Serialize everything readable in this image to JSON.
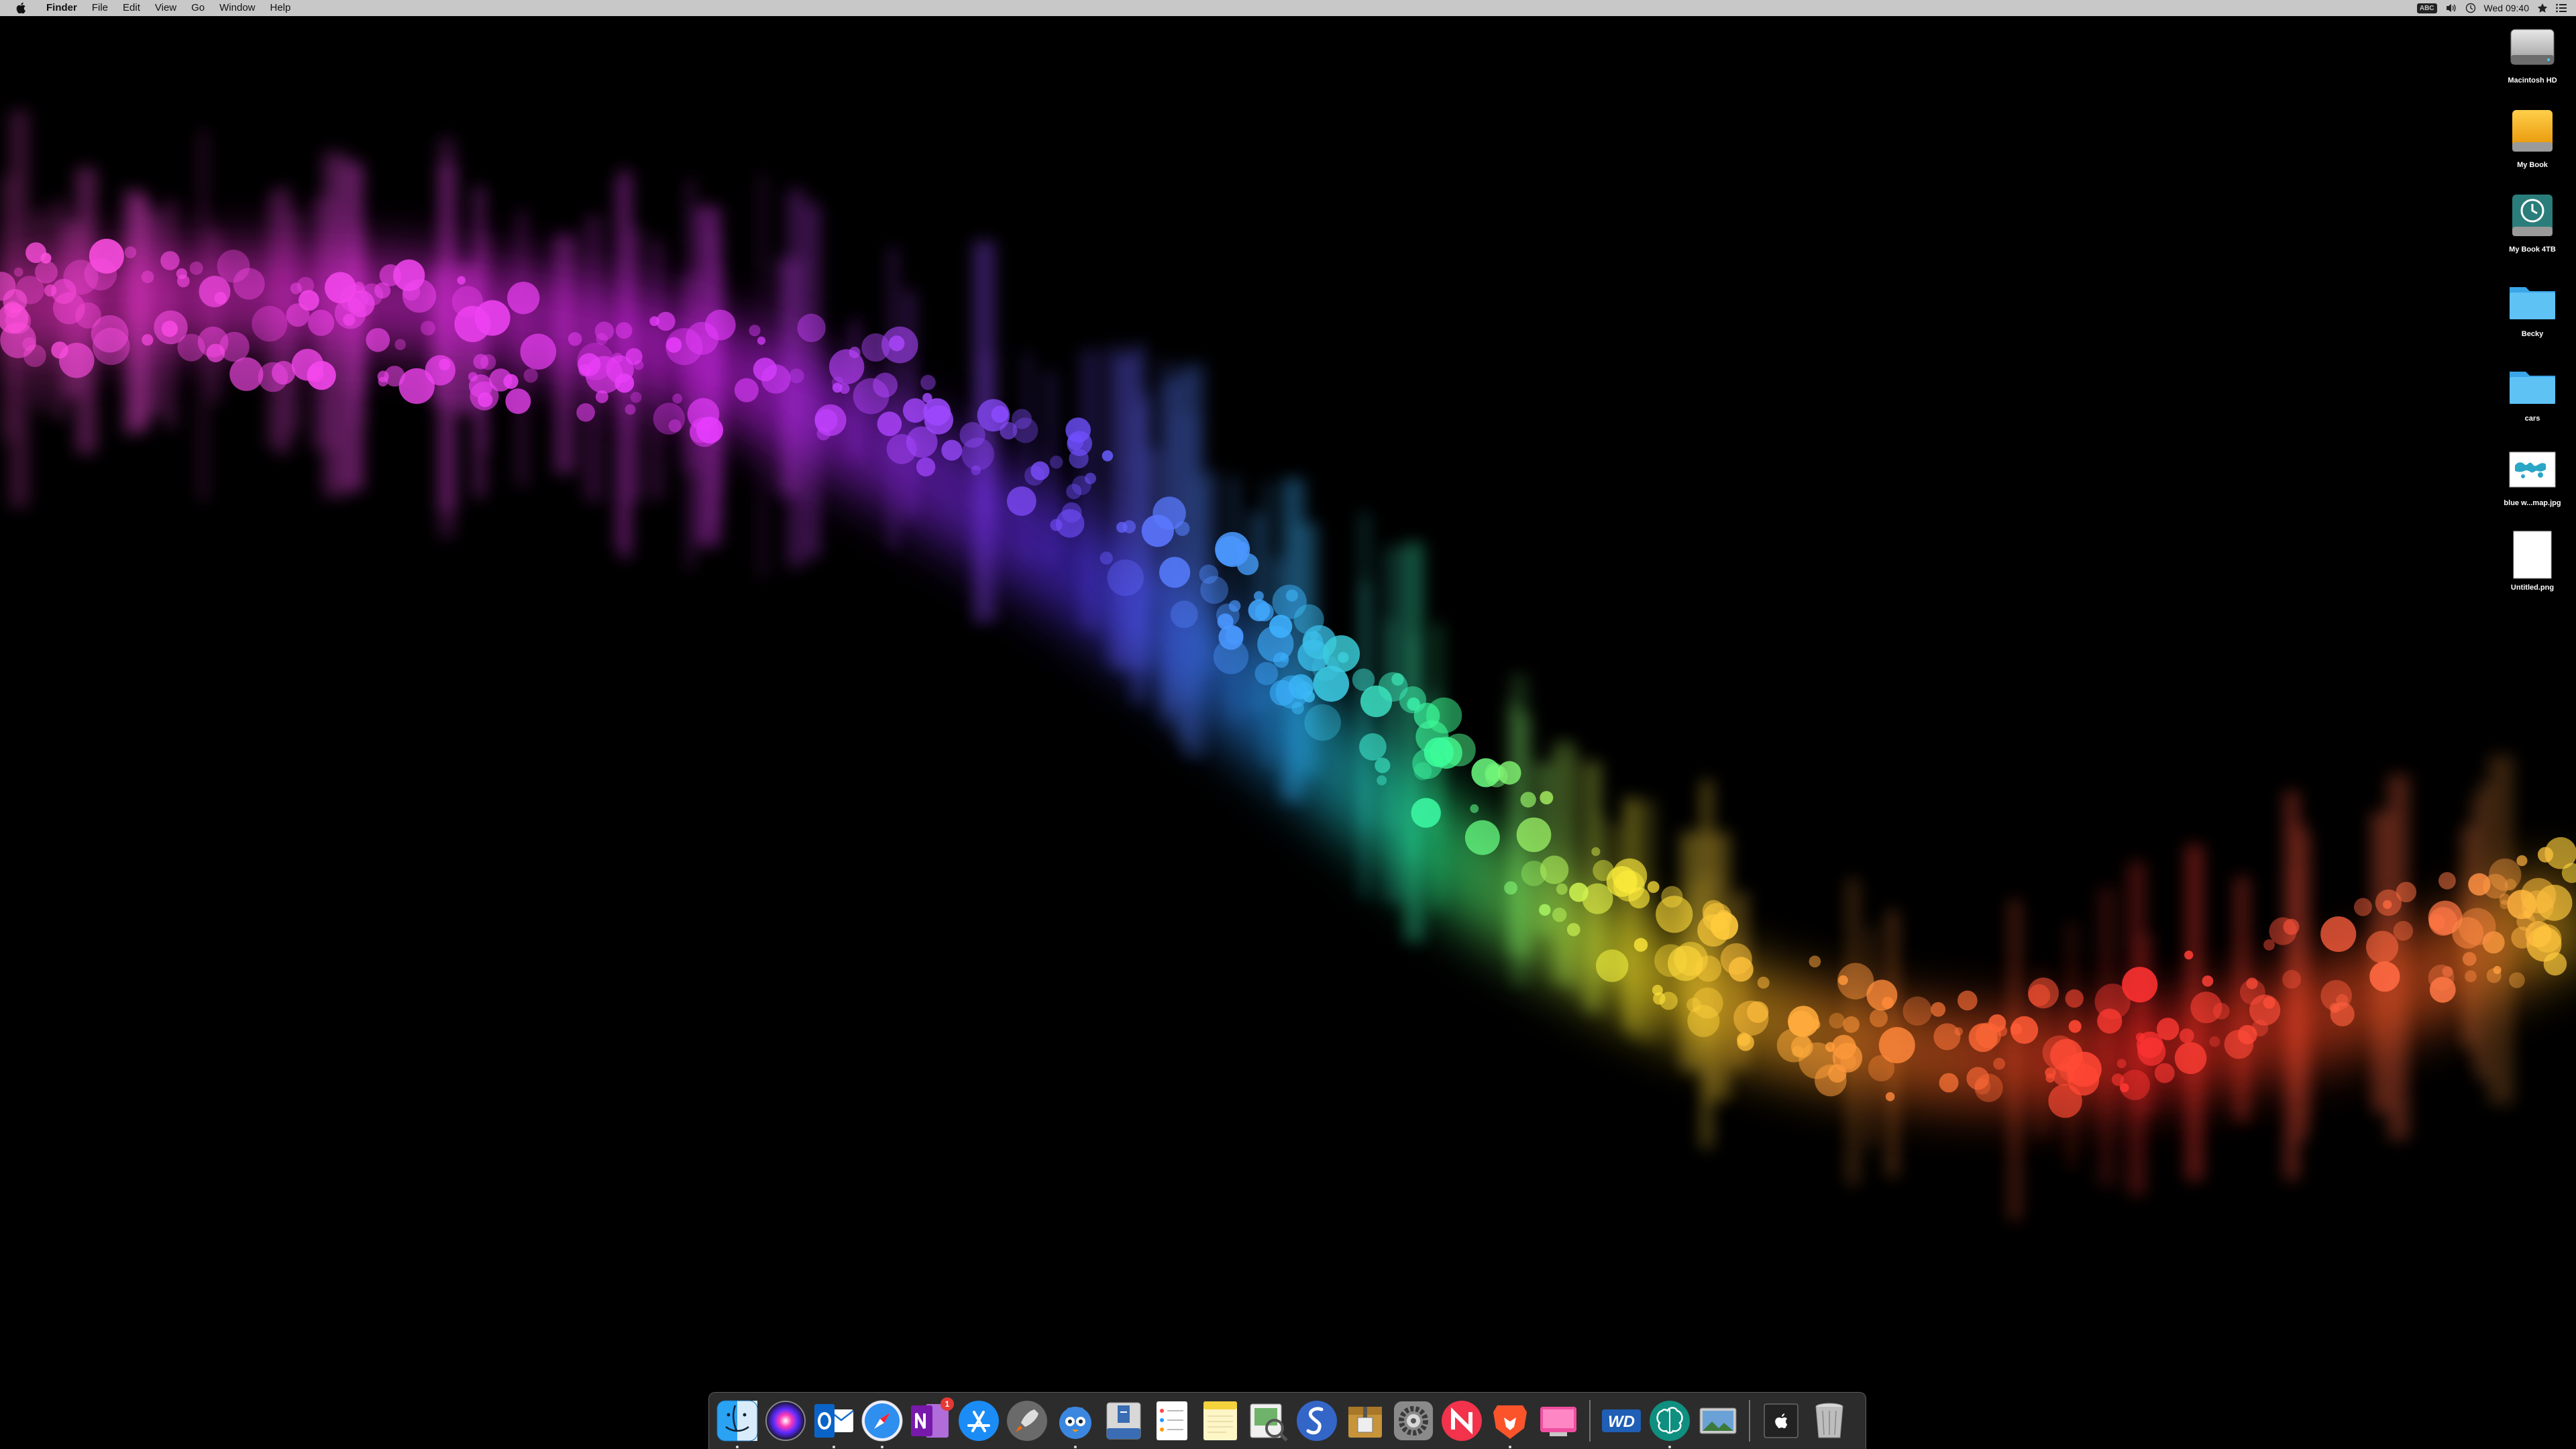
{
  "menubar": {
    "app_name": "Finder",
    "menus": [
      "File",
      "Edit",
      "View",
      "Go",
      "Window",
      "Help"
    ],
    "status": {
      "keyboard_badge": "ABC",
      "clock": "Wed 09:40"
    }
  },
  "desktop": {
    "icons": [
      {
        "label": "Macintosh HD",
        "icon": "hard-drive-icon"
      },
      {
        "label": "My Book",
        "icon": "external-drive-icon"
      },
      {
        "label": "My Book 4TB",
        "icon": "time-machine-drive-icon"
      },
      {
        "label": "Becky",
        "icon": "folder-icon"
      },
      {
        "label": "cars",
        "icon": "folder-icon"
      },
      {
        "label": "blue w...map.jpg",
        "icon": "image-file-icon"
      },
      {
        "label": "Untitled.png",
        "icon": "blank-image-file-icon"
      }
    ]
  },
  "dock": {
    "apps": [
      {
        "name": "Finder",
        "icon": "finder-icon",
        "running": true
      },
      {
        "name": "Siri",
        "icon": "siri-icon",
        "running": false
      },
      {
        "name": "Outlook",
        "icon": "outlook-icon",
        "running": true
      },
      {
        "name": "Safari",
        "icon": "safari-icon",
        "running": true
      },
      {
        "name": "OneNote",
        "icon": "onenote-icon",
        "running": false,
        "badge": "1"
      },
      {
        "name": "App Store",
        "icon": "app-store-icon",
        "running": false
      },
      {
        "name": "Launchpad",
        "icon": "launchpad-icon",
        "running": false
      },
      {
        "name": "Tweetbot",
        "icon": "tweetbot-icon",
        "running": true
      },
      {
        "name": "Disk Utility",
        "icon": "disk-utility-icon",
        "running": false
      },
      {
        "name": "Reminders",
        "icon": "reminders-icon",
        "running": false
      },
      {
        "name": "Notes",
        "icon": "notes-icon",
        "running": false
      },
      {
        "name": "Preview",
        "icon": "preview-icon",
        "running": false
      },
      {
        "name": "Simplenote",
        "icon": "simplenote-icon",
        "running": false
      },
      {
        "name": "Archive Utility",
        "icon": "archive-icon",
        "running": false
      },
      {
        "name": "System Preferences",
        "icon": "gear-icon",
        "running": false
      },
      {
        "name": "News",
        "icon": "news-icon",
        "running": false
      },
      {
        "name": "Brave",
        "icon": "brave-icon",
        "running": true
      },
      {
        "name": "CleanMyMac",
        "icon": "cleanmymac-icon",
        "running": false
      },
      {
        "name": "WD Discovery",
        "icon": "wd-icon",
        "running": false
      },
      {
        "name": "Mind Node",
        "icon": "brain-icon",
        "running": true
      },
      {
        "name": "Photo Slideshow",
        "icon": "photos-slideshow-icon",
        "running": false
      }
    ],
    "others": [
      {
        "name": "Apple Folder",
        "icon": "apple-folder-icon"
      },
      {
        "name": "Trash",
        "icon": "trash-icon"
      }
    ]
  }
}
